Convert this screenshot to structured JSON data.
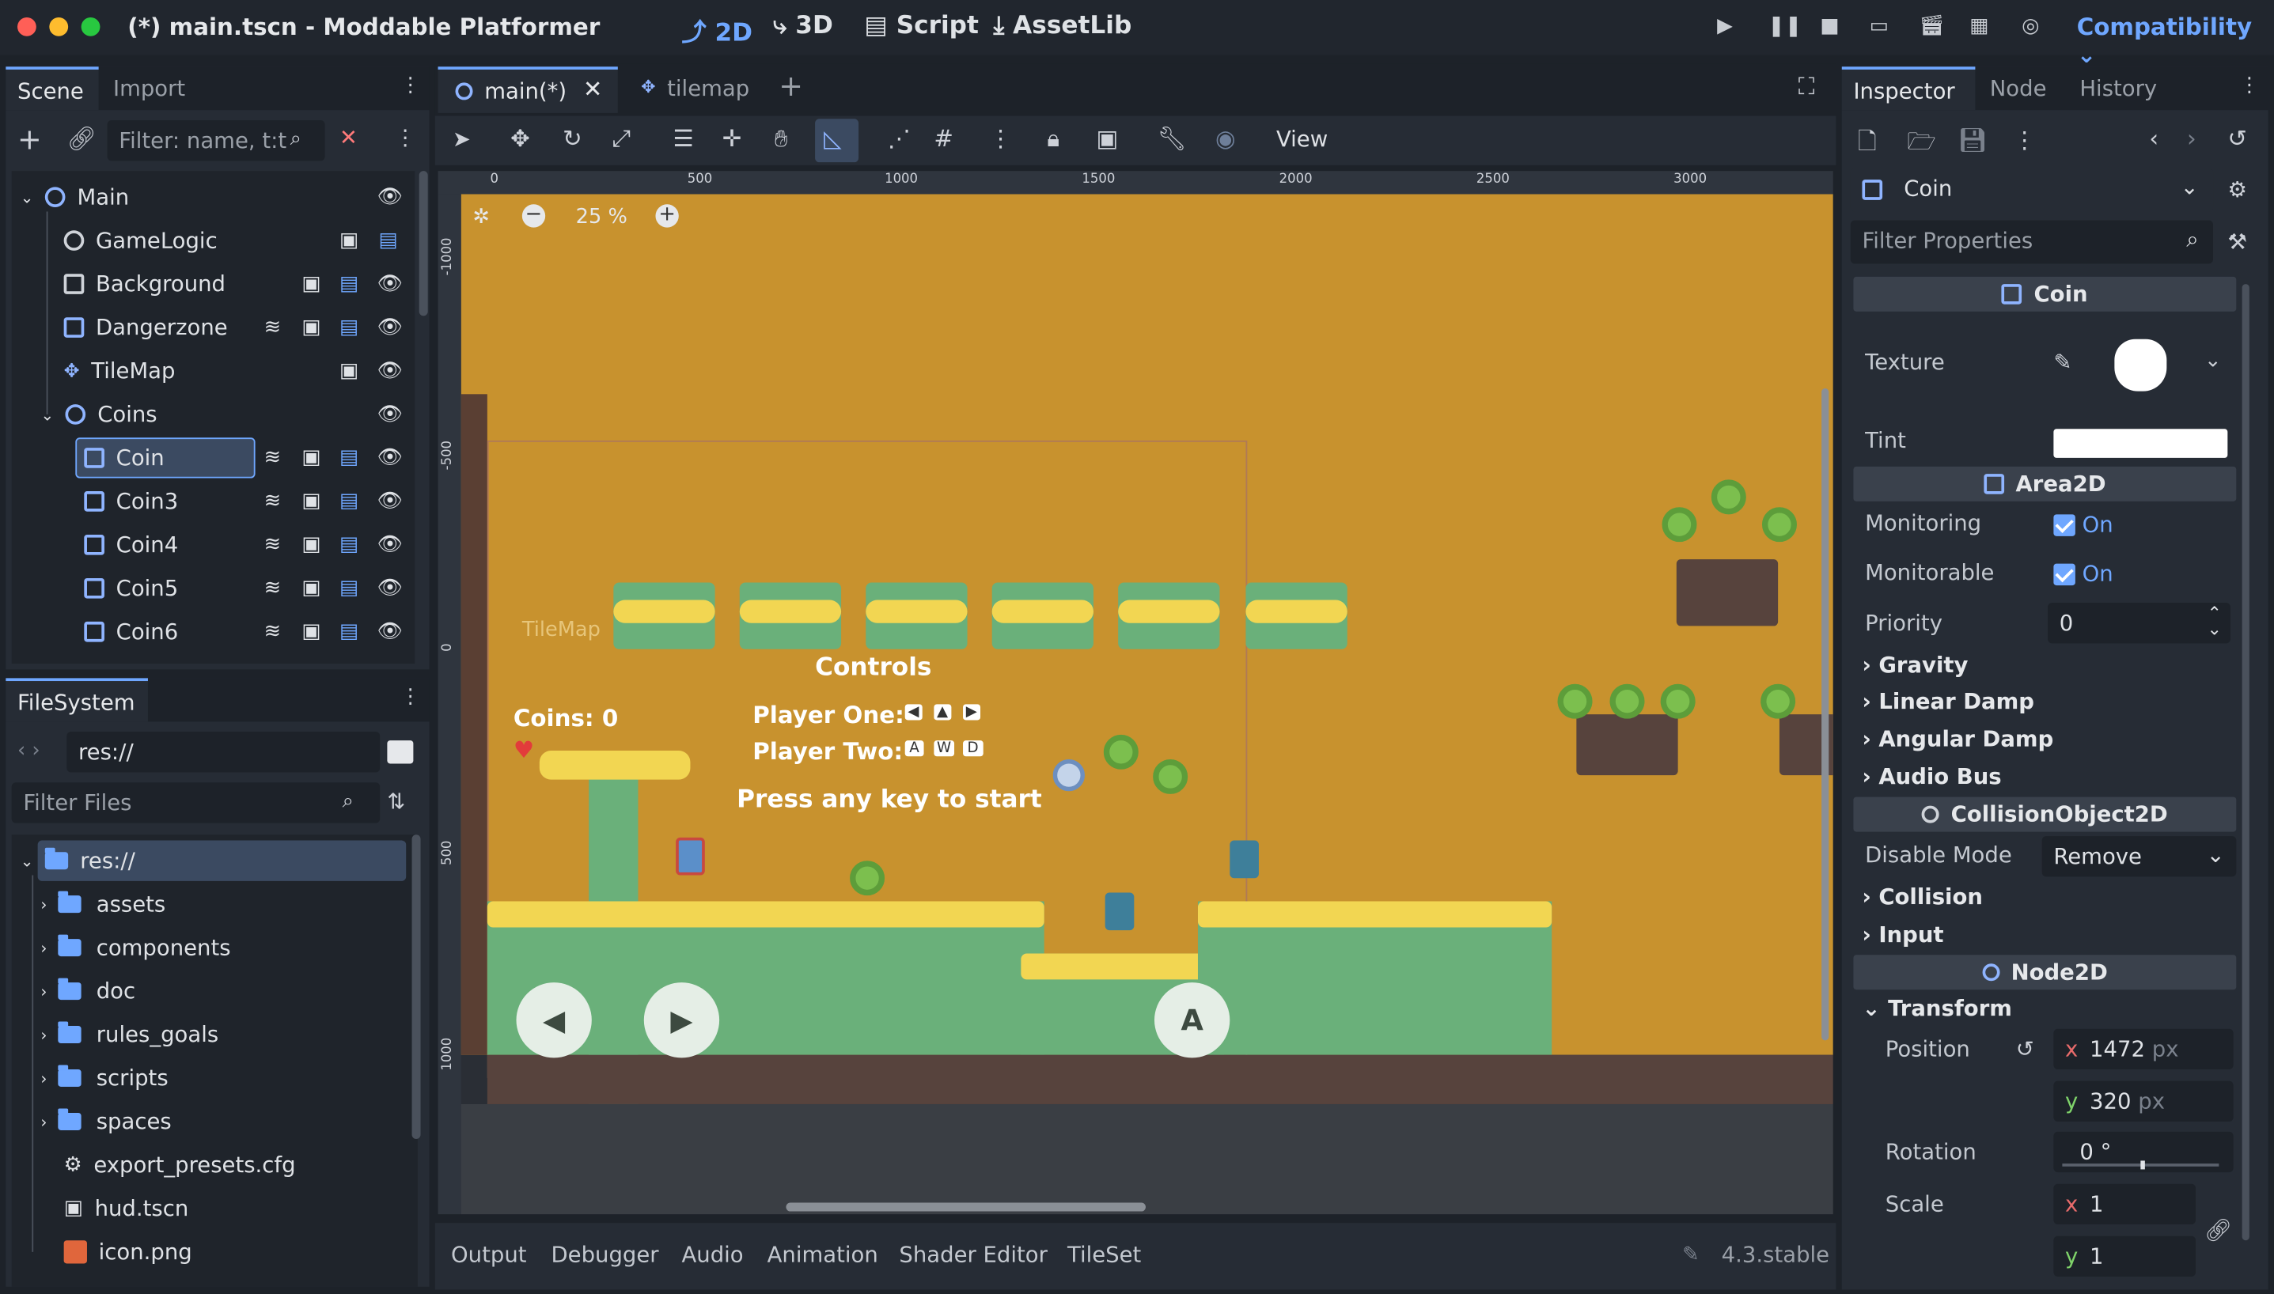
{
  "window": {
    "title": "(*) main.tscn - Moddable Platformer"
  },
  "workspaces": {
    "w2d": "2D",
    "w3d": "3D",
    "script": "Script",
    "assetlib": "AssetLib"
  },
  "renderer": "Compatibility",
  "scene_dock": {
    "tabs": {
      "scene": "Scene",
      "import": "Import"
    },
    "filter_placeholder": "Filter: name, t:t",
    "nodes": [
      {
        "label": "Main"
      },
      {
        "label": "GameLogic"
      },
      {
        "label": "Background"
      },
      {
        "label": "Dangerzone"
      },
      {
        "label": "TileMap"
      },
      {
        "label": "Coins"
      },
      {
        "label": "Coin"
      },
      {
        "label": "Coin3"
      },
      {
        "label": "Coin4"
      },
      {
        "label": "Coin5"
      },
      {
        "label": "Coin6"
      }
    ]
  },
  "filesystem": {
    "tab": "FileSystem",
    "path": "res://",
    "filter_placeholder": "Filter Files",
    "items": [
      {
        "label": "res://"
      },
      {
        "label": "assets"
      },
      {
        "label": "components"
      },
      {
        "label": "doc"
      },
      {
        "label": "rules_goals"
      },
      {
        "label": "scripts"
      },
      {
        "label": "spaces"
      },
      {
        "label": "export_presets.cfg"
      },
      {
        "label": "hud.tscn"
      },
      {
        "label": "icon.png"
      }
    ]
  },
  "editor_tabs": {
    "main": "main(*)",
    "tilemap": "tilemap"
  },
  "toolbar": {
    "view": "View"
  },
  "viewport": {
    "zoom": "25 %",
    "ruler_h": [
      "0",
      "500",
      "1000",
      "1500",
      "2000",
      "2500",
      "3000"
    ],
    "ruler_v": [
      "-1000",
      "-500",
      "0",
      "500",
      "1000"
    ],
    "tilemap_label": "TileMap",
    "hud_coins": "Coins: 0",
    "controls_title": "Controls",
    "player_one": "Player One:",
    "player_two": "Player Two:",
    "press_start": "Press any key to start",
    "p2_keys": [
      "A",
      "W",
      "D"
    ],
    "action_button": "A"
  },
  "bottom_panel": {
    "tabs": [
      "Output",
      "Debugger",
      "Audio",
      "Animation",
      "Shader Editor",
      "TileSet"
    ],
    "version": "4.3.stable"
  },
  "inspector": {
    "tabs": {
      "inspector": "Inspector",
      "node": "Node",
      "history": "History"
    },
    "object": "Coin",
    "filter_placeholder": "Filter Properties",
    "sections": {
      "coin": "Coin",
      "area2d": "Area2D",
      "collision": "CollisionObject2D",
      "node2d": "Node2D"
    },
    "texture_label": "Texture",
    "tint_label": "Tint",
    "monitoring_label": "Monitoring",
    "monitoring_value": "On",
    "monitorable_label": "Monitorable",
    "monitorable_value": "On",
    "priority_label": "Priority",
    "priority_value": "0",
    "groups": {
      "gravity": "Gravity",
      "linear_damp": "Linear Damp",
      "angular_damp": "Angular Damp",
      "audio_bus": "Audio Bus",
      "collision": "Collision",
      "input": "Input",
      "transform": "Transform"
    },
    "disable_mode_label": "Disable Mode",
    "disable_mode_value": "Remove",
    "position_label": "Position",
    "position_x": "1472",
    "position_y": "320",
    "unit": "px",
    "rotation_label": "Rotation",
    "rotation_value": "0 °",
    "scale_label": "Scale",
    "scale_x": "1",
    "scale_y": "1",
    "axis_x": "x",
    "axis_y": "y"
  },
  "colors": {
    "accent": "#6fa7ff",
    "sky": "#c8922e",
    "grass": "#6ab07a",
    "dirt": "#57433d"
  }
}
